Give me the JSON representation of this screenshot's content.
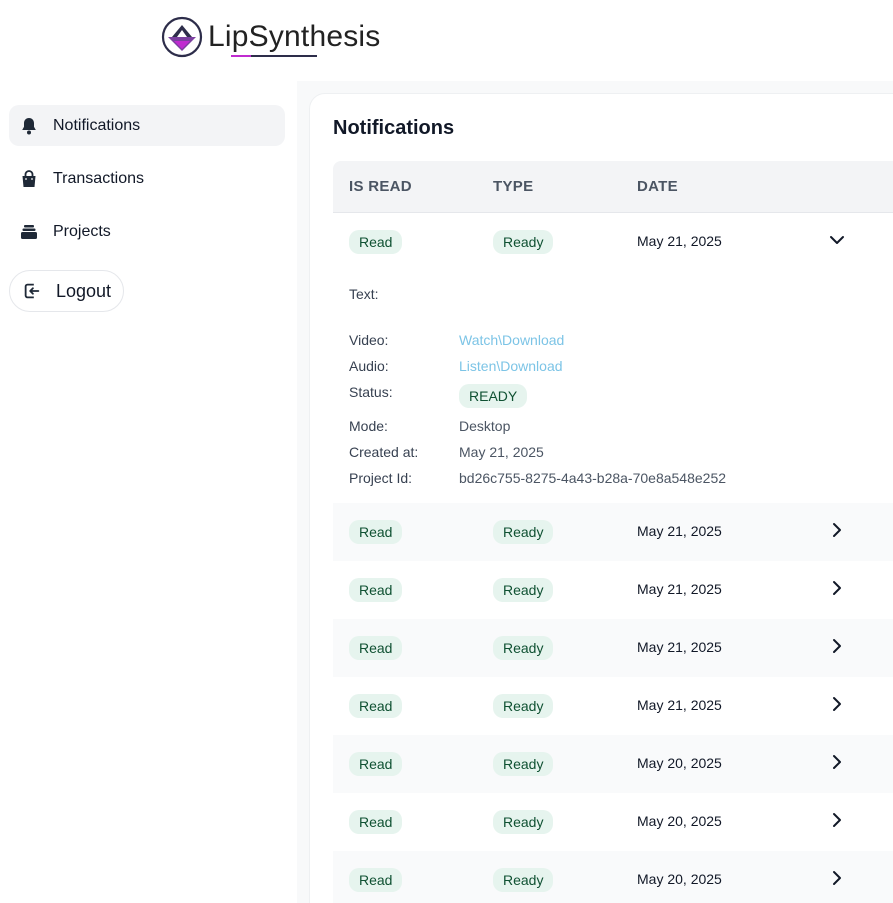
{
  "brand": {
    "name": "LipSynthesis",
    "colors": {
      "purple": "#7b3fa0",
      "violet": "#c02bd0",
      "dark": "#2d2d4a"
    }
  },
  "sidebar": {
    "items": [
      {
        "label": "Notifications",
        "icon": "bell-icon",
        "active": true
      },
      {
        "label": "Transactions",
        "icon": "shopping-bag-icon",
        "active": false
      },
      {
        "label": "Projects",
        "icon": "stack-icon",
        "active": false
      }
    ],
    "logout_label": "Logout"
  },
  "page": {
    "title": "Notifications"
  },
  "table": {
    "headers": [
      "IS READ",
      "TYPE",
      "DATE"
    ],
    "expanded_row": {
      "is_read": "Read",
      "type": "Ready",
      "date": "May 21, 2025",
      "details": {
        "text_label": "Text:",
        "text_value": "",
        "video_label": "Video:",
        "video_value": "Watch\\Download",
        "audio_label": "Audio:",
        "audio_value": "Listen\\Download",
        "status_label": "Status:",
        "status_value": "READY",
        "mode_label": "Mode:",
        "mode_value": "Desktop",
        "created_label": "Created at:",
        "created_value": "May 21, 2025",
        "project_label": "Project Id:",
        "project_value": "bd26c755-8275-4a43-b28a-70e8a548e252"
      }
    },
    "rows": [
      {
        "is_read": "Read",
        "type": "Ready",
        "date": "May 21, 2025"
      },
      {
        "is_read": "Read",
        "type": "Ready",
        "date": "May 21, 2025"
      },
      {
        "is_read": "Read",
        "type": "Ready",
        "date": "May 21, 2025"
      },
      {
        "is_read": "Read",
        "type": "Ready",
        "date": "May 21, 2025"
      },
      {
        "is_read": "Read",
        "type": "Ready",
        "date": "May 20, 2025"
      },
      {
        "is_read": "Read",
        "type": "Ready",
        "date": "May 20, 2025"
      },
      {
        "is_read": "Read",
        "type": "Ready",
        "date": "May 20, 2025"
      }
    ]
  },
  "colors": {
    "badge_bg": "#e6f4ee",
    "badge_text": "#0f5132",
    "link": "#7cc4e6"
  }
}
